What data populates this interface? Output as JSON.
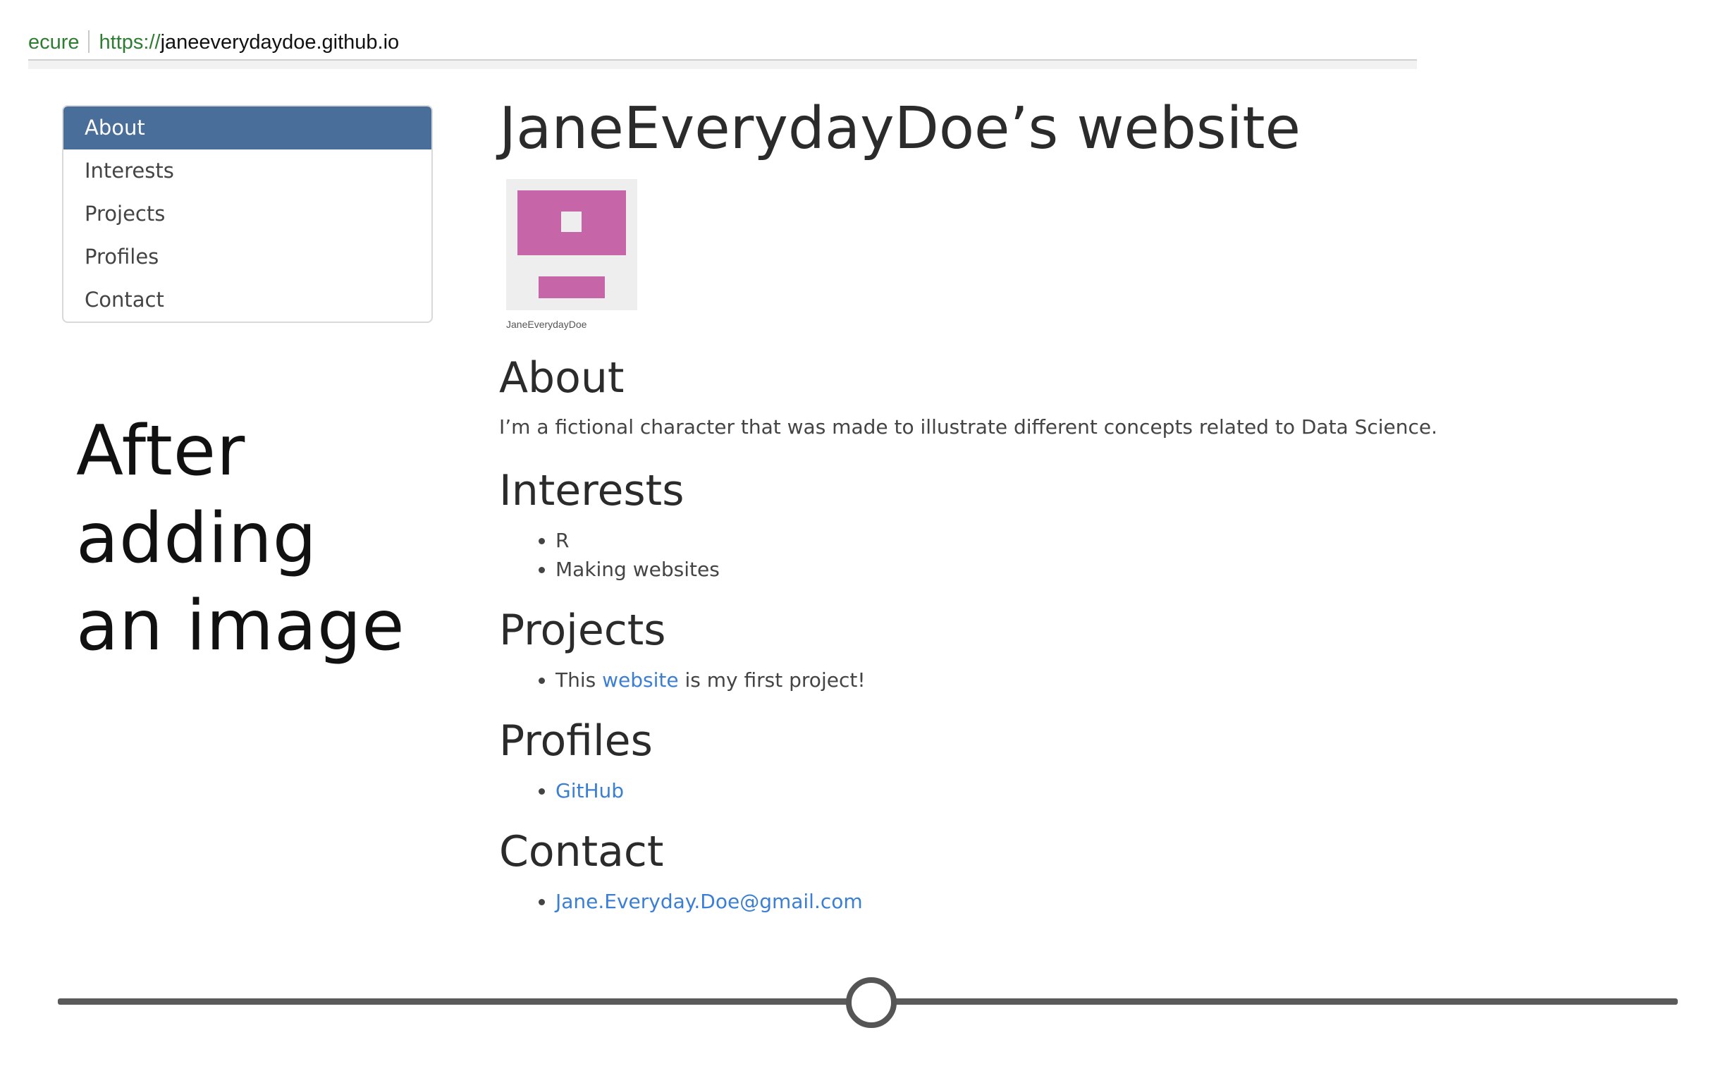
{
  "browser": {
    "secure_label": "ecure",
    "url_scheme": "https://",
    "url_host": "janeeverydaydoe.github.io"
  },
  "sidebar": {
    "items": [
      {
        "label": "About",
        "active": true
      },
      {
        "label": "Interests",
        "active": false
      },
      {
        "label": "Projects",
        "active": false
      },
      {
        "label": "Profiles",
        "active": false
      },
      {
        "label": "Contact",
        "active": false
      }
    ]
  },
  "caption": {
    "line1": "After",
    "line2": "adding",
    "line3": "an image"
  },
  "main": {
    "title": "JaneEverydayDoe’s website",
    "avatar_caption": "JaneEverydayDoe",
    "about": {
      "heading": "About",
      "text": "I’m a fictional character that was made to illustrate different concepts related to Data Science."
    },
    "interests": {
      "heading": "Interests",
      "items": [
        "R",
        "Making websites"
      ]
    },
    "projects": {
      "heading": "Projects",
      "prefix": "This ",
      "link": "website",
      "suffix": " is my first project!"
    },
    "profiles": {
      "heading": "Profiles",
      "link": "GitHub"
    },
    "contact": {
      "heading": "Contact",
      "email": "Jane.Everyday.Doe@gmail.com"
    }
  },
  "timeline": {
    "position": 0.5
  },
  "colors": {
    "nav_active_bg": "#4a6e9a",
    "link": "#3b7fd4",
    "avatar_accent": "#c665a8",
    "secure_green": "#2e7d32"
  }
}
